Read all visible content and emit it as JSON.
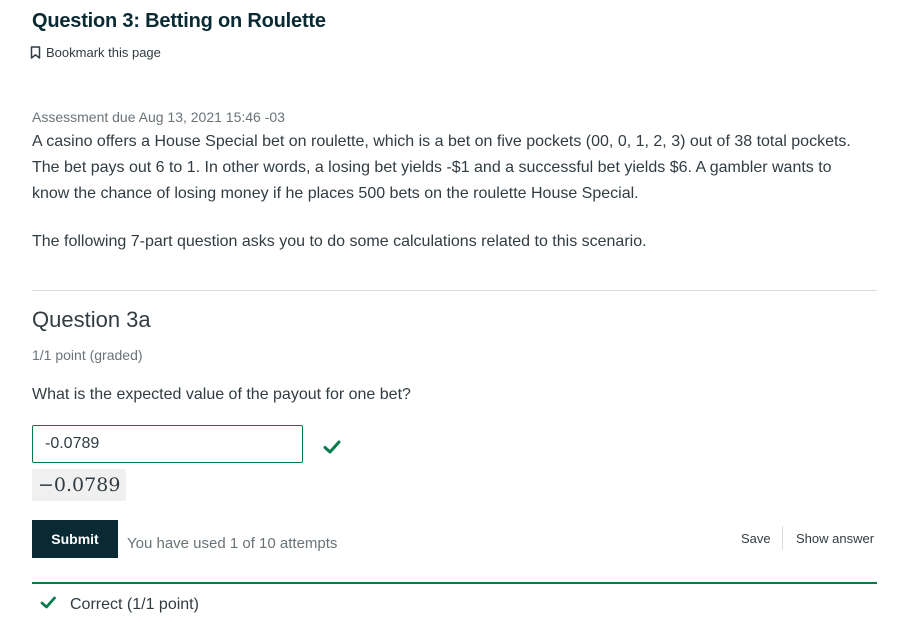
{
  "page": {
    "title": "Question 3: Betting on Roulette",
    "bookmark_label": "Bookmark this page"
  },
  "assessment": {
    "due": "Assessment due Aug 13, 2021 15:46 -03"
  },
  "problem": {
    "text": "A casino offers a House Special bet on roulette, which is a bet on five pockets (00, 0, 1, 2, 3) out of 38 total pockets. The bet pays out 6 to 1. In other words, a losing bet yields -$1 and a successful bet yields $6. A gambler wants to know the chance of losing money if he places 500 bets on the roulette House Special.",
    "intro": "The following 7-part question asks you to do some calculations related to this scenario."
  },
  "question": {
    "heading": "Question 3a",
    "points": "1/1 point (graded)",
    "prompt": "What is the expected value of the payout for one bet?",
    "answer_value": "-0.0789",
    "math_preview": "−0.0789",
    "status": "correct"
  },
  "actions": {
    "submit_label": "Submit",
    "attempts_text": "You have used 1 of 10 attempts",
    "save_label": "Save",
    "show_answer_label": "Show answer"
  },
  "feedback": {
    "text": "Correct (1/1 point)"
  },
  "colors": {
    "title": "#0a2a33",
    "success": "#0b7a4b",
    "submit_bg": "#0a2a33",
    "muted_text": "#6a7378"
  },
  "icons": {
    "bookmark": "bookmark-outline-icon",
    "correct": "check-icon"
  }
}
